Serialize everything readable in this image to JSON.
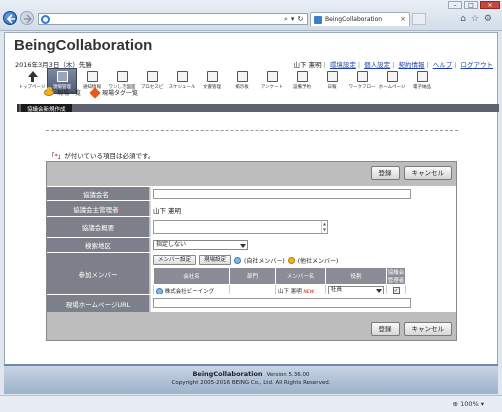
{
  "browser": {
    "tab_title": "BeingCollaboration",
    "zoom": "100%"
  },
  "app": {
    "brand": "BeingCollaboration",
    "date": "2016年3月3日（木）先勝",
    "user_name": "山下 憲明",
    "links": [
      "環境設定",
      "個人設定",
      "契約情報",
      "ヘルプ",
      "ログアウト"
    ]
  },
  "toolbar": [
    {
      "label": "トップページ",
      "icon": "home-arrow-icon",
      "active": false
    },
    {
      "label": "現場管理",
      "icon": "site-icon",
      "active": true
    },
    {
      "label": "通知情報",
      "icon": "mail-icon",
      "active": false
    },
    {
      "label": "ワンしき図面",
      "icon": "drawing-icon",
      "active": false
    },
    {
      "label": "プロセスビ",
      "icon": "process-icon",
      "active": false
    },
    {
      "label": "スケジュール",
      "icon": "calendar-icon",
      "active": false
    },
    {
      "label": "文書管理",
      "icon": "folder-icon",
      "active": false
    },
    {
      "label": "掲示板",
      "icon": "board-icon",
      "active": false
    },
    {
      "label": "アンケート",
      "icon": "survey-icon",
      "active": false
    },
    {
      "label": "設備予約",
      "icon": "reservation-icon",
      "active": false
    },
    {
      "label": "日報",
      "icon": "report-icon",
      "active": false
    },
    {
      "label": "ワークフロー",
      "icon": "workflow-icon",
      "active": false
    },
    {
      "label": "ホームページ",
      "icon": "homepage-icon",
      "active": false
    },
    {
      "label": "電子納品",
      "icon": "delivery-icon",
      "active": false
    }
  ],
  "section_title": "協議会新規作成",
  "subnav": [
    "現場一覧",
    "現場タグ一覧"
  ],
  "required_note": {
    "mark": "*",
    "text": "が付いている項目は必須です。"
  },
  "buttons": {
    "register": "登録",
    "cancel": "キャンセル"
  },
  "form": {
    "name_label": "協議会名",
    "admin_label": "協議会主管理者",
    "admin_value": "山下 憲明",
    "summary_label": "協議会概要",
    "region_label": "検索地区",
    "region_value": "指定しない",
    "members_label": "参加メンバー",
    "member_settings_btn": "メンバー設定",
    "site_settings_btn": "現場設定",
    "legend_own": "(自社メンバー)",
    "legend_other": "(他社メンバー)",
    "homepage_label": "現場ホームページURL"
  },
  "member_table": {
    "headers": [
      "会社名",
      "部門",
      "メンバー名",
      "役割",
      "協議会管理者"
    ],
    "rows": [
      {
        "company": "株式会社ビーイング",
        "dept": "",
        "member": "山下 憲明",
        "badge": "NEW",
        "role": "社員",
        "admin": "✓"
      }
    ]
  },
  "footer": {
    "product": "BeingCollaboration",
    "version": "Version 5.36.00",
    "copyright": "Copyright 2005-2016 BEING Co., Ltd. All Rights Reserved."
  }
}
